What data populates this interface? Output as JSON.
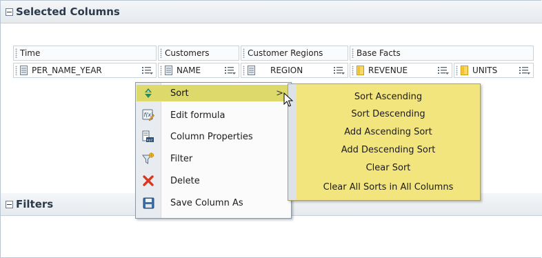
{
  "selected_columns": {
    "title": "Selected Columns",
    "groups": [
      "Time",
      "Customers",
      "Customer Regions",
      "Base Facts"
    ],
    "columns": [
      {
        "label": "PER_NAME_YEAR",
        "kind": "attribute"
      },
      {
        "label": "NAME",
        "kind": "attribute"
      },
      {
        "label": "REGION",
        "kind": "attribute"
      },
      {
        "label": "REVENUE",
        "kind": "measure"
      },
      {
        "label": "UNITS",
        "kind": "measure"
      }
    ]
  },
  "context_menu": {
    "items": [
      {
        "label": "Sort",
        "icon": "sort-icon",
        "has_submenu": true,
        "submenu_arrow": ">"
      },
      {
        "label": "Edit formula",
        "icon": "edit-formula-icon"
      },
      {
        "label": "Column Properties",
        "icon": "column-properties-icon"
      },
      {
        "label": "Filter",
        "icon": "filter-icon"
      },
      {
        "label": "Delete",
        "icon": "delete-icon"
      },
      {
        "label": "Save Column As",
        "icon": "save-icon"
      }
    ]
  },
  "sort_submenu": {
    "items": [
      "Sort Ascending",
      "Sort Descending",
      "Add Ascending Sort",
      "Add Descending Sort",
      "Clear Sort",
      "Clear All Sorts in All Columns"
    ]
  },
  "filters": {
    "title": "Filters"
  },
  "colors": {
    "menu_highlight": "#ddd96a",
    "submenu_background": "#f3e57d",
    "measure_icon": "#f2c12e",
    "attribute_icon": "#6a7e94"
  }
}
